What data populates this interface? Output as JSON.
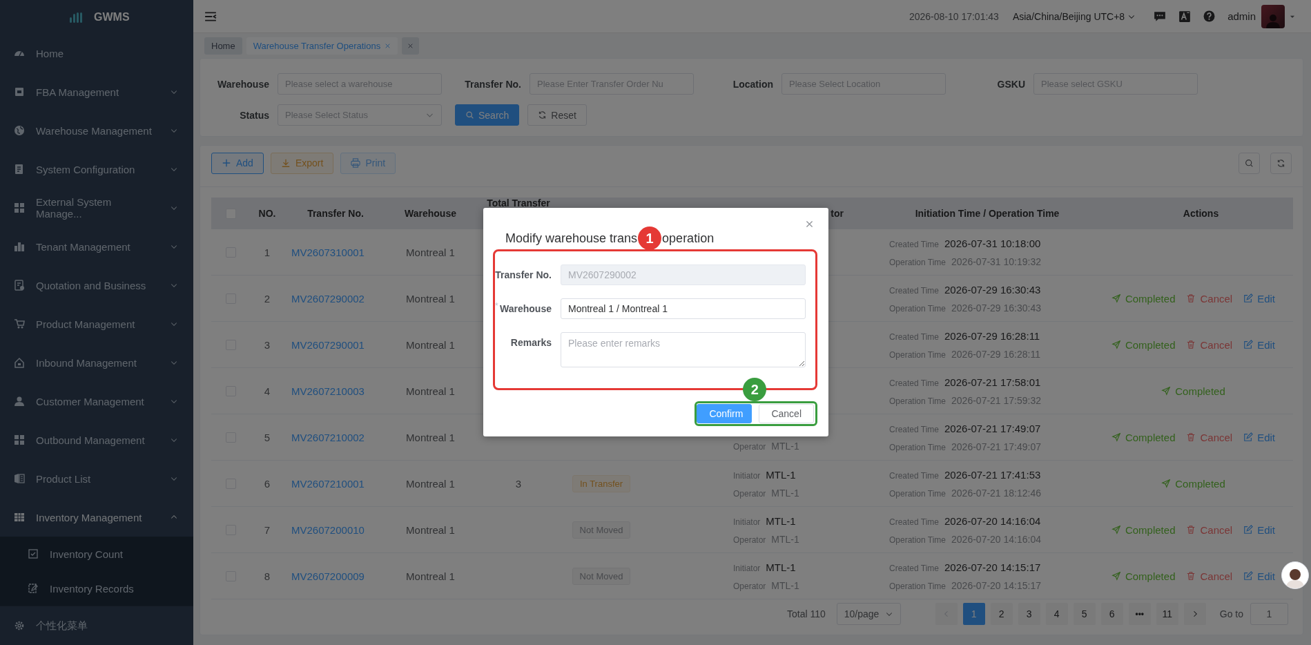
{
  "sidebar": {
    "logo_text": "GWMS",
    "items": [
      {
        "label": "Home",
        "kind": "link",
        "expanded": false
      },
      {
        "label": "FBA Management",
        "kind": "group",
        "expanded": false
      },
      {
        "label": "Warehouse Management",
        "kind": "group",
        "expanded": false
      },
      {
        "label": "System Configuration",
        "kind": "group",
        "expanded": false
      },
      {
        "label": "External System Manage...",
        "kind": "group",
        "expanded": false
      },
      {
        "label": "Tenant Management",
        "kind": "group",
        "expanded": false
      },
      {
        "label": "Quotation and Business",
        "kind": "group",
        "expanded": false
      },
      {
        "label": "Product Management",
        "kind": "group",
        "expanded": false
      },
      {
        "label": "Inbound Management",
        "kind": "group",
        "expanded": false
      },
      {
        "label": "Customer Management",
        "kind": "group",
        "expanded": false
      },
      {
        "label": "Outbound Management",
        "kind": "group",
        "expanded": false
      },
      {
        "label": "Product List",
        "kind": "group",
        "expanded": false
      },
      {
        "label": "Inventory Management",
        "kind": "group",
        "expanded": true,
        "children": [
          {
            "label": "Inventory Count"
          },
          {
            "label": "Inventory Records"
          }
        ]
      }
    ],
    "footer": "个性化菜单"
  },
  "topbar": {
    "datetime": "2026-08-10 17:01:43",
    "timezone": "Asia/China/Beijing UTC+8",
    "user": "admin"
  },
  "tabs": [
    {
      "label": "Home",
      "selected": false,
      "closable": false
    },
    {
      "label": "Warehouse Transfer Operations",
      "selected": true,
      "closable": true
    }
  ],
  "filters": [
    {
      "label": "Warehouse",
      "placeholder": "Please select a warehouse",
      "kind": "input"
    },
    {
      "label": "Transfer No.",
      "placeholder": "Please Enter Transfer Order Nu",
      "kind": "input"
    },
    {
      "label": "Location",
      "placeholder": "Please Select Location",
      "kind": "input"
    },
    {
      "label": "GSKU",
      "placeholder": "Please select GSKU",
      "kind": "input"
    },
    {
      "label": "Status",
      "placeholder": "Please Select Status",
      "kind": "select"
    }
  ],
  "filter_buttons": [
    {
      "label": "Search",
      "kind": "primary"
    },
    {
      "label": "Reset",
      "kind": "default"
    }
  ],
  "toolbar": [
    {
      "label": "Add",
      "kind": "primary",
      "disabled": false
    },
    {
      "label": "Export",
      "kind": "warning",
      "disabled": false
    },
    {
      "label": "Print",
      "kind": "primary",
      "disabled": true
    }
  ],
  "table": {
    "header_checkbox": {
      "checked": false
    },
    "columns": [
      {
        "label": "NO.",
        "kind": "no"
      },
      {
        "label": "Transfer No.",
        "kind": "transfer_no"
      },
      {
        "label": "Warehouse",
        "kind": "warehouse"
      },
      {
        "label": "Total Transfer",
        "kind": "total"
      },
      {
        "label": "tor",
        "kind": "initiator"
      },
      {
        "label": "Initiation Time / Operation Time",
        "kind": "time"
      },
      {
        "label": "Actions",
        "kind": "actions"
      }
    ],
    "rows": [
      {
        "checked": false,
        "no": "1",
        "transfer_no": "MV2607310001",
        "warehouse": "Montreal 1",
        "created": {
          "label": "Created Time",
          "value": "2026-07-31 10:18:00"
        },
        "operated": {
          "label": "Operation Time",
          "value": "2026-07-31 10:19:32"
        }
      },
      {
        "checked": false,
        "no": "2",
        "transfer_no": "MV2607290002",
        "warehouse": "Montreal 1",
        "created": {
          "label": "Created Time",
          "value": "2026-07-29 16:30:43"
        },
        "operated": {
          "label": "Operation Time",
          "value": "2026-07-29 16:30:43"
        },
        "actions": [
          {
            "label": "Completed",
            "kind": "success"
          },
          {
            "label": "Cancel",
            "kind": "danger"
          },
          {
            "label": "Edit",
            "kind": "primary"
          }
        ]
      },
      {
        "checked": false,
        "no": "3",
        "transfer_no": "MV2607290001",
        "warehouse": "Montreal 1",
        "created": {
          "label": "Created Time",
          "value": "2026-07-29 16:28:11"
        },
        "operated": {
          "label": "Operation Time",
          "value": "2026-07-29 16:28:11"
        },
        "actions": [
          {
            "label": "Completed",
            "kind": "success"
          },
          {
            "label": "Cancel",
            "kind": "danger"
          },
          {
            "label": "Edit",
            "kind": "primary"
          }
        ]
      },
      {
        "checked": false,
        "no": "4",
        "transfer_no": "MV2607210003",
        "warehouse": "Montreal 1",
        "created": {
          "label": "Created Time",
          "value": "2026-07-21 17:58:01"
        },
        "operated": {
          "label": "Operation Time",
          "value": "2026-07-21 17:59:32"
        },
        "actions": [
          {
            "label": "Completed",
            "kind": "success"
          }
        ]
      },
      {
        "checked": false,
        "no": "5",
        "transfer_no": "MV2607210002",
        "warehouse": "Montreal 1",
        "operator": {
          "label": "Operator",
          "value": "MTL-1"
        },
        "created": {
          "label": "Created Time",
          "value": "2026-07-21 17:49:07"
        },
        "operated": {
          "label": "Operation Time",
          "value": "2026-07-21 17:49:07"
        },
        "actions": [
          {
            "label": "Completed",
            "kind": "success"
          },
          {
            "label": "Cancel",
            "kind": "danger"
          },
          {
            "label": "Edit",
            "kind": "primary"
          }
        ]
      },
      {
        "checked": false,
        "no": "6",
        "transfer_no": "MV2607210001",
        "warehouse": "Montreal 1",
        "total": "3",
        "status": {
          "label": "In Transfer",
          "kind": "warning"
        },
        "initiator": {
          "label": "Initiator",
          "value": "MTL-1"
        },
        "operator": {
          "label": "Operator",
          "value": "MTL-1"
        },
        "created": {
          "label": "Created Time",
          "value": "2026-07-21 17:41:53"
        },
        "operated": {
          "label": "Operation Time",
          "value": "2026-07-21 18:12:46"
        },
        "actions": [
          {
            "label": "Completed",
            "kind": "success"
          }
        ]
      },
      {
        "checked": false,
        "no": "7",
        "transfer_no": "MV2607200010",
        "warehouse": "Montreal 1",
        "status": {
          "label": "Not Moved",
          "kind": "info"
        },
        "initiator": {
          "label": "Initiator",
          "value": "MTL-1"
        },
        "operator": {
          "label": "Operator",
          "value": "MTL-1"
        },
        "created": {
          "label": "Created Time",
          "value": "2026-07-20 14:16:04"
        },
        "operated": {
          "label": "Operation Time",
          "value": "2026-07-20 14:16:04"
        },
        "actions": [
          {
            "label": "Completed",
            "kind": "success"
          },
          {
            "label": "Cancel",
            "kind": "danger"
          },
          {
            "label": "Edit",
            "kind": "primary"
          }
        ]
      },
      {
        "checked": false,
        "no": "8",
        "transfer_no": "MV2607200009",
        "warehouse": "Montreal 1",
        "status": {
          "label": "Not Moved",
          "kind": "info"
        },
        "initiator": {
          "label": "Initiator",
          "value": "MTL-1"
        },
        "operator": {
          "label": "Operator",
          "value": "MTL-1"
        },
        "created": {
          "label": "Created Time",
          "value": "2026-07-20 14:15:17"
        },
        "operated": {
          "label": "Operation Time",
          "value": "2026-07-20 14:15:17"
        },
        "actions": [
          {
            "label": "Completed",
            "kind": "success"
          },
          {
            "label": "Cancel",
            "kind": "danger"
          },
          {
            "label": "Edit",
            "kind": "primary"
          }
        ]
      }
    ]
  },
  "pagination": {
    "total": "Total 110",
    "page_size": "10/page",
    "prev_disabled": true,
    "next_disabled": false,
    "pages": [
      {
        "label": "1",
        "selected": true,
        "kind": "page"
      },
      {
        "label": "2",
        "selected": false,
        "kind": "page"
      },
      {
        "label": "3",
        "selected": false,
        "kind": "page"
      },
      {
        "label": "4",
        "selected": false,
        "kind": "page"
      },
      {
        "label": "5",
        "selected": false,
        "kind": "page"
      },
      {
        "label": "6",
        "selected": false,
        "kind": "page"
      },
      {
        "label": "•••",
        "selected": false,
        "kind": "more"
      },
      {
        "label": "11",
        "selected": false,
        "kind": "page"
      }
    ],
    "goto_label": "Go to",
    "goto_value": "1"
  },
  "modal": {
    "title_parts": [
      "Modify warehouse trans",
      "operation"
    ],
    "fields": [
      {
        "label": "Transfer No.",
        "value": "MV2607290002",
        "kind": "input",
        "disabled": true
      },
      {
        "label": "Warehouse",
        "value": "Montreal 1 / Montreal 1",
        "kind": "input",
        "disabled": false,
        "required_mark": "*"
      },
      {
        "label": "Remarks",
        "placeholder": "Please enter remarks",
        "kind": "textarea",
        "disabled": false
      }
    ],
    "buttons": [
      {
        "label": "Confirm",
        "kind": "primary"
      },
      {
        "label": "Cancel",
        "kind": "default"
      }
    ]
  },
  "annotations": [
    {
      "number": "1",
      "color": "#e53935"
    },
    {
      "number": "2",
      "color": "#3a9d3f"
    }
  ]
}
